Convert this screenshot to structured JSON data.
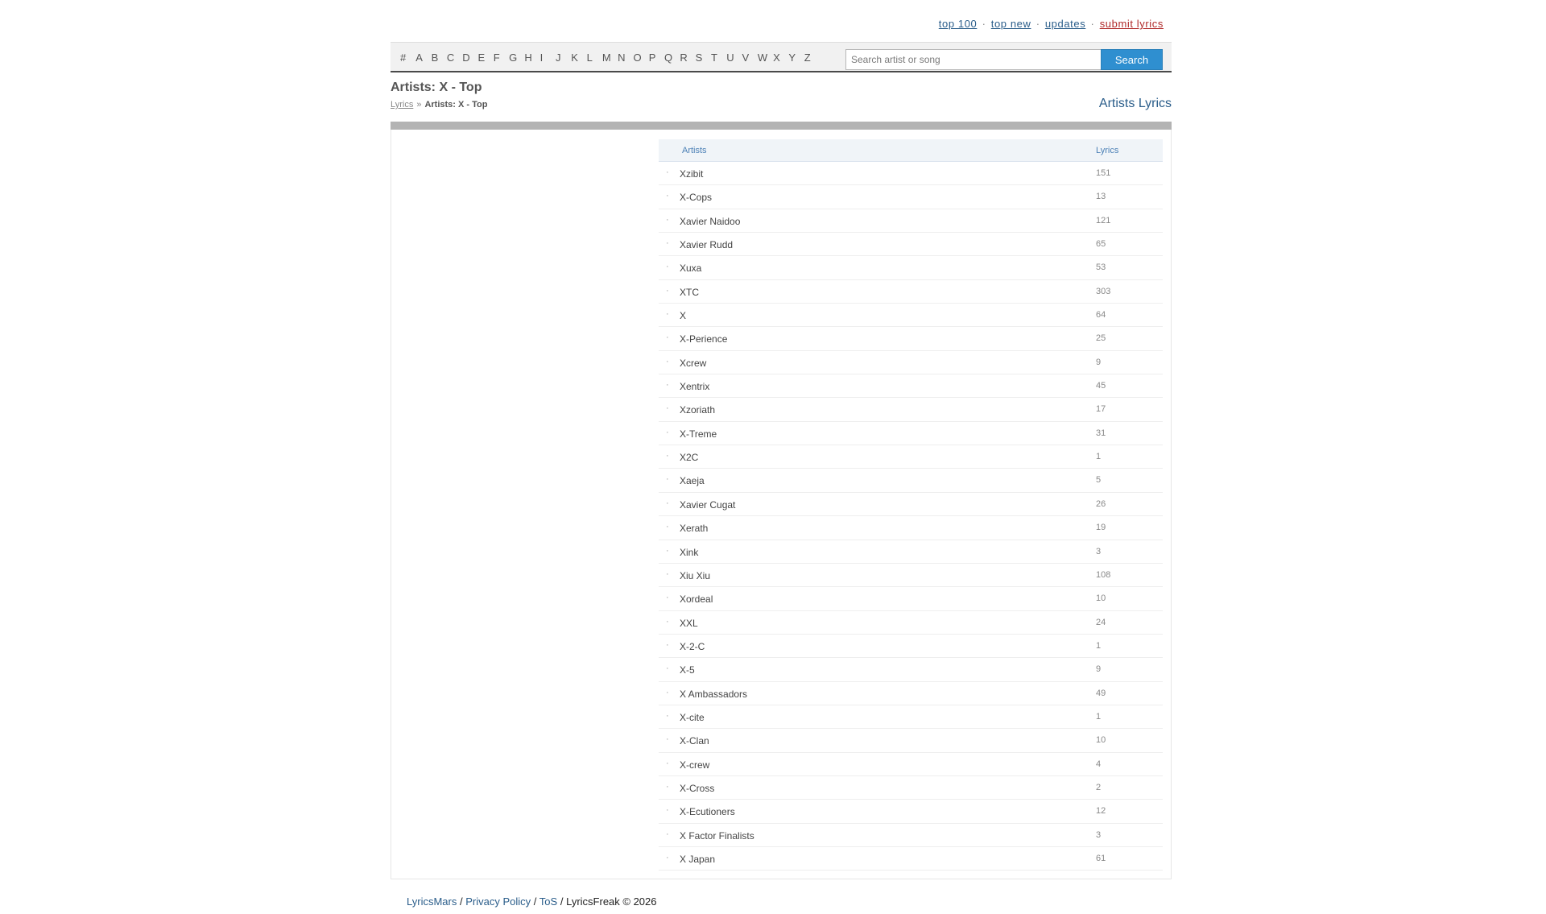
{
  "top_nav": {
    "top100": "top 100",
    "top_new": "top new",
    "updates": "updates",
    "submit": "submit lyrics",
    "separator": "·"
  },
  "alphabet": [
    "#",
    "A",
    "B",
    "C",
    "D",
    "E",
    "F",
    "G",
    "H",
    "I",
    "J",
    "K",
    "L",
    "M",
    "N",
    "O",
    "P",
    "Q",
    "R",
    "S",
    "T",
    "U",
    "V",
    "W",
    "X",
    "Y",
    "Z"
  ],
  "search": {
    "placeholder": "Search artist or song",
    "button_label": "Search"
  },
  "page_title": "Artists: X - Top",
  "breadcrumb": {
    "root": "Lyrics",
    "separator": "»",
    "current": "Artists: X - Top"
  },
  "right_title": "Artists Lyrics",
  "table": {
    "header_artists": "Artists",
    "header_lyrics": "Lyrics",
    "rows": [
      {
        "artist": "Xzibit",
        "lyrics": "151"
      },
      {
        "artist": "X-Cops",
        "lyrics": "13"
      },
      {
        "artist": "Xavier Naidoo",
        "lyrics": "121"
      },
      {
        "artist": "Xavier Rudd",
        "lyrics": "65"
      },
      {
        "artist": "Xuxa",
        "lyrics": "53"
      },
      {
        "artist": "XTC",
        "lyrics": "303"
      },
      {
        "artist": "X",
        "lyrics": "64"
      },
      {
        "artist": "X-Perience",
        "lyrics": "25"
      },
      {
        "artist": "Xcrew",
        "lyrics": "9"
      },
      {
        "artist": "Xentrix",
        "lyrics": "45"
      },
      {
        "artist": "Xzoriath",
        "lyrics": "17"
      },
      {
        "artist": "X-Treme",
        "lyrics": "31"
      },
      {
        "artist": "X2C",
        "lyrics": "1"
      },
      {
        "artist": "Xaeja",
        "lyrics": "5"
      },
      {
        "artist": "Xavier Cugat",
        "lyrics": "26"
      },
      {
        "artist": "Xerath",
        "lyrics": "19"
      },
      {
        "artist": "Xink",
        "lyrics": "3"
      },
      {
        "artist": "Xiu Xiu",
        "lyrics": "108"
      },
      {
        "artist": "Xordeal",
        "lyrics": "10"
      },
      {
        "artist": "XXL",
        "lyrics": "24"
      },
      {
        "artist": "X-2-C",
        "lyrics": "1"
      },
      {
        "artist": "X-5",
        "lyrics": "9"
      },
      {
        "artist": "X Ambassadors",
        "lyrics": "49"
      },
      {
        "artist": "X-cite",
        "lyrics": "1"
      },
      {
        "artist": "X-Clan",
        "lyrics": "10"
      },
      {
        "artist": "X-crew",
        "lyrics": "4"
      },
      {
        "artist": "X-Cross",
        "lyrics": "2"
      },
      {
        "artist": "X-Ecutioners",
        "lyrics": "12"
      },
      {
        "artist": "X Factor Finalists",
        "lyrics": "3"
      },
      {
        "artist": "X Japan",
        "lyrics": "61"
      }
    ]
  },
  "footer": {
    "site": "LyricsMars",
    "privacy": "Privacy Policy",
    "tos": "ToS",
    "sep": "/",
    "copyright": "LyricsFreak © 2026"
  },
  "colors": {
    "link_blue": "#2a5d8a",
    "submit_red": "#b02a2a",
    "search_button": "#2f8fd0",
    "header_bg": "#f0f4f8"
  }
}
